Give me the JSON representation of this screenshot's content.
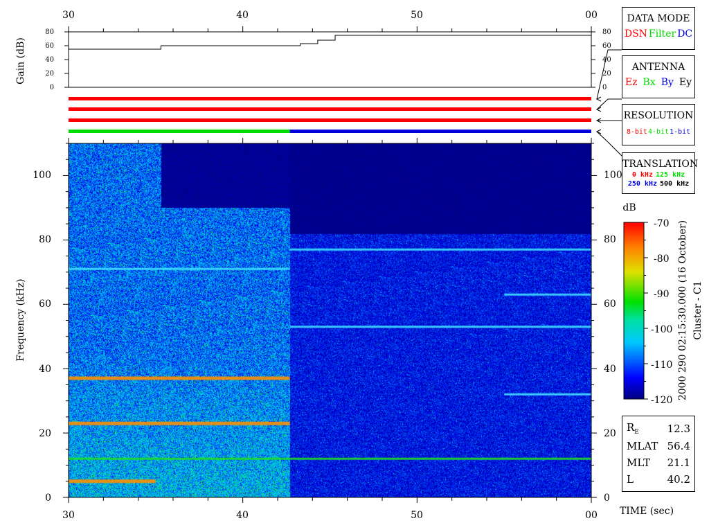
{
  "colors": {
    "red": "#ff0000",
    "green": "#00dd00",
    "blue": "#0000dd",
    "spectrogram_background": "#000a60",
    "noise_blue": "#1a3ccc"
  },
  "gain_panel": {
    "ylabel": "Gain (dB)",
    "yticks": [
      "80",
      "60",
      "40",
      "20",
      "0"
    ]
  },
  "time_axis": {
    "tick_labels": [
      "30",
      "40",
      "50",
      "00"
    ],
    "xlabel": "TIME (sec)"
  },
  "freq_axis": {
    "ylabel": "Frequency (kHz)",
    "tick_labels": [
      "0",
      "20",
      "40",
      "60",
      "80",
      "100"
    ]
  },
  "colorbar": {
    "unit": "dB",
    "tick_labels": [
      "-70",
      "-80",
      "-90",
      "-100",
      "-110",
      "-120"
    ]
  },
  "side_caption": {
    "date_line": "2000 290 02:15:30.000 (16 October)",
    "spacecraft": "Cluster - C1"
  },
  "data_mode": {
    "title": "DATA MODE",
    "items": [
      {
        "label": "DSN",
        "color": "#ff0000"
      },
      {
        "label": "Filter",
        "color": "#00dd00"
      },
      {
        "label": "DC",
        "color": "#0000dd"
      }
    ]
  },
  "antenna": {
    "title": "ANTENNA",
    "items": [
      {
        "label": "Ez",
        "color": "#ff0000"
      },
      {
        "label": "Bx",
        "color": "#00dd00"
      },
      {
        "label": "By",
        "color": "#0000dd"
      },
      {
        "label": "Ey",
        "color": "#000000"
      }
    ]
  },
  "resolution": {
    "title": "RESOLUTION",
    "items": [
      {
        "label": "8-bit",
        "color": "#ff0000"
      },
      {
        "label": "4-bit",
        "color": "#00dd00"
      },
      {
        "label": "1-bit",
        "color": "#0000dd"
      }
    ]
  },
  "translation": {
    "title": "TRANSLATION",
    "row1": [
      {
        "label": "0 kHz",
        "color": "#ff0000"
      },
      {
        "label": "125 kHz",
        "color": "#00dd00"
      }
    ],
    "row2": [
      {
        "label": "250 kHz",
        "color": "#0000dd"
      },
      {
        "label": "500 kHz",
        "color": "#000000"
      }
    ]
  },
  "info": {
    "re_label": "R",
    "re_sub": "E",
    "re_value": "12.3",
    "mlat_label": "MLAT",
    "mlat_value": "56.4",
    "mlt_label": "MLT",
    "mlt_value": "21.1",
    "l_label": "L",
    "l_value": "40.2"
  },
  "chart_data": [
    {
      "type": "line",
      "title": "",
      "xlabel": "",
      "ylabel": "Gain (dB)",
      "x_unit": "sec",
      "xlim": [
        30,
        60
      ],
      "ylim": [
        0,
        80
      ],
      "series": [
        {
          "x": [
            30,
            35.3,
            35.3,
            43.3,
            43.3,
            44.3,
            44.3,
            45.3,
            45.3,
            60
          ],
          "y": [
            55,
            55,
            60,
            60,
            63,
            63,
            68,
            68,
            75,
            75
          ]
        }
      ]
    },
    {
      "type": "bar",
      "title": "",
      "bars": [
        {
          "segments": [
            {
              "start": 30,
              "end": 60,
              "color": "#ff0000"
            }
          ]
        },
        {
          "segments": [
            {
              "start": 30,
              "end": 60,
              "color": "#ff0000"
            }
          ]
        },
        {
          "segments": [
            {
              "start": 30,
              "end": 60,
              "color": "#ff0000"
            }
          ]
        },
        {
          "segments": [
            {
              "start": 30,
              "end": 42.7,
              "color": "#00dd00"
            },
            {
              "start": 42.7,
              "end": 60,
              "color": "#0000dd"
            }
          ]
        }
      ]
    },
    {
      "type": "heatmap",
      "title": "",
      "xlabel": "TIME (sec)",
      "ylabel": "Frequency (kHz)",
      "xlim": [
        30,
        60
      ],
      "ylim": [
        0,
        110
      ],
      "colorbar_range_db": [
        -120,
        -70
      ],
      "spectral_lines_khz": [
        {
          "f": 5,
          "t0": 30,
          "t1": 35,
          "level": "orange"
        },
        {
          "f": 12,
          "t0": 30,
          "t1": 60,
          "level": "green"
        },
        {
          "f": 23,
          "t0": 30,
          "t1": 42.7,
          "level": "orange"
        },
        {
          "f": 37,
          "t0": 30,
          "t1": 42.7,
          "level": "orange"
        },
        {
          "f": 77,
          "t0": 42.7,
          "t1": 60,
          "level": "cyan"
        },
        {
          "f": 53,
          "t0": 42.7,
          "t1": 60,
          "level": "cyan"
        },
        {
          "f": 63,
          "t0": 55,
          "t1": 60,
          "level": "cyan"
        },
        {
          "f": 32,
          "t0": 55,
          "t1": 60,
          "level": "cyan"
        },
        {
          "f": 71,
          "t0": 30,
          "t1": 42.7,
          "level": "cyan"
        }
      ]
    }
  ]
}
